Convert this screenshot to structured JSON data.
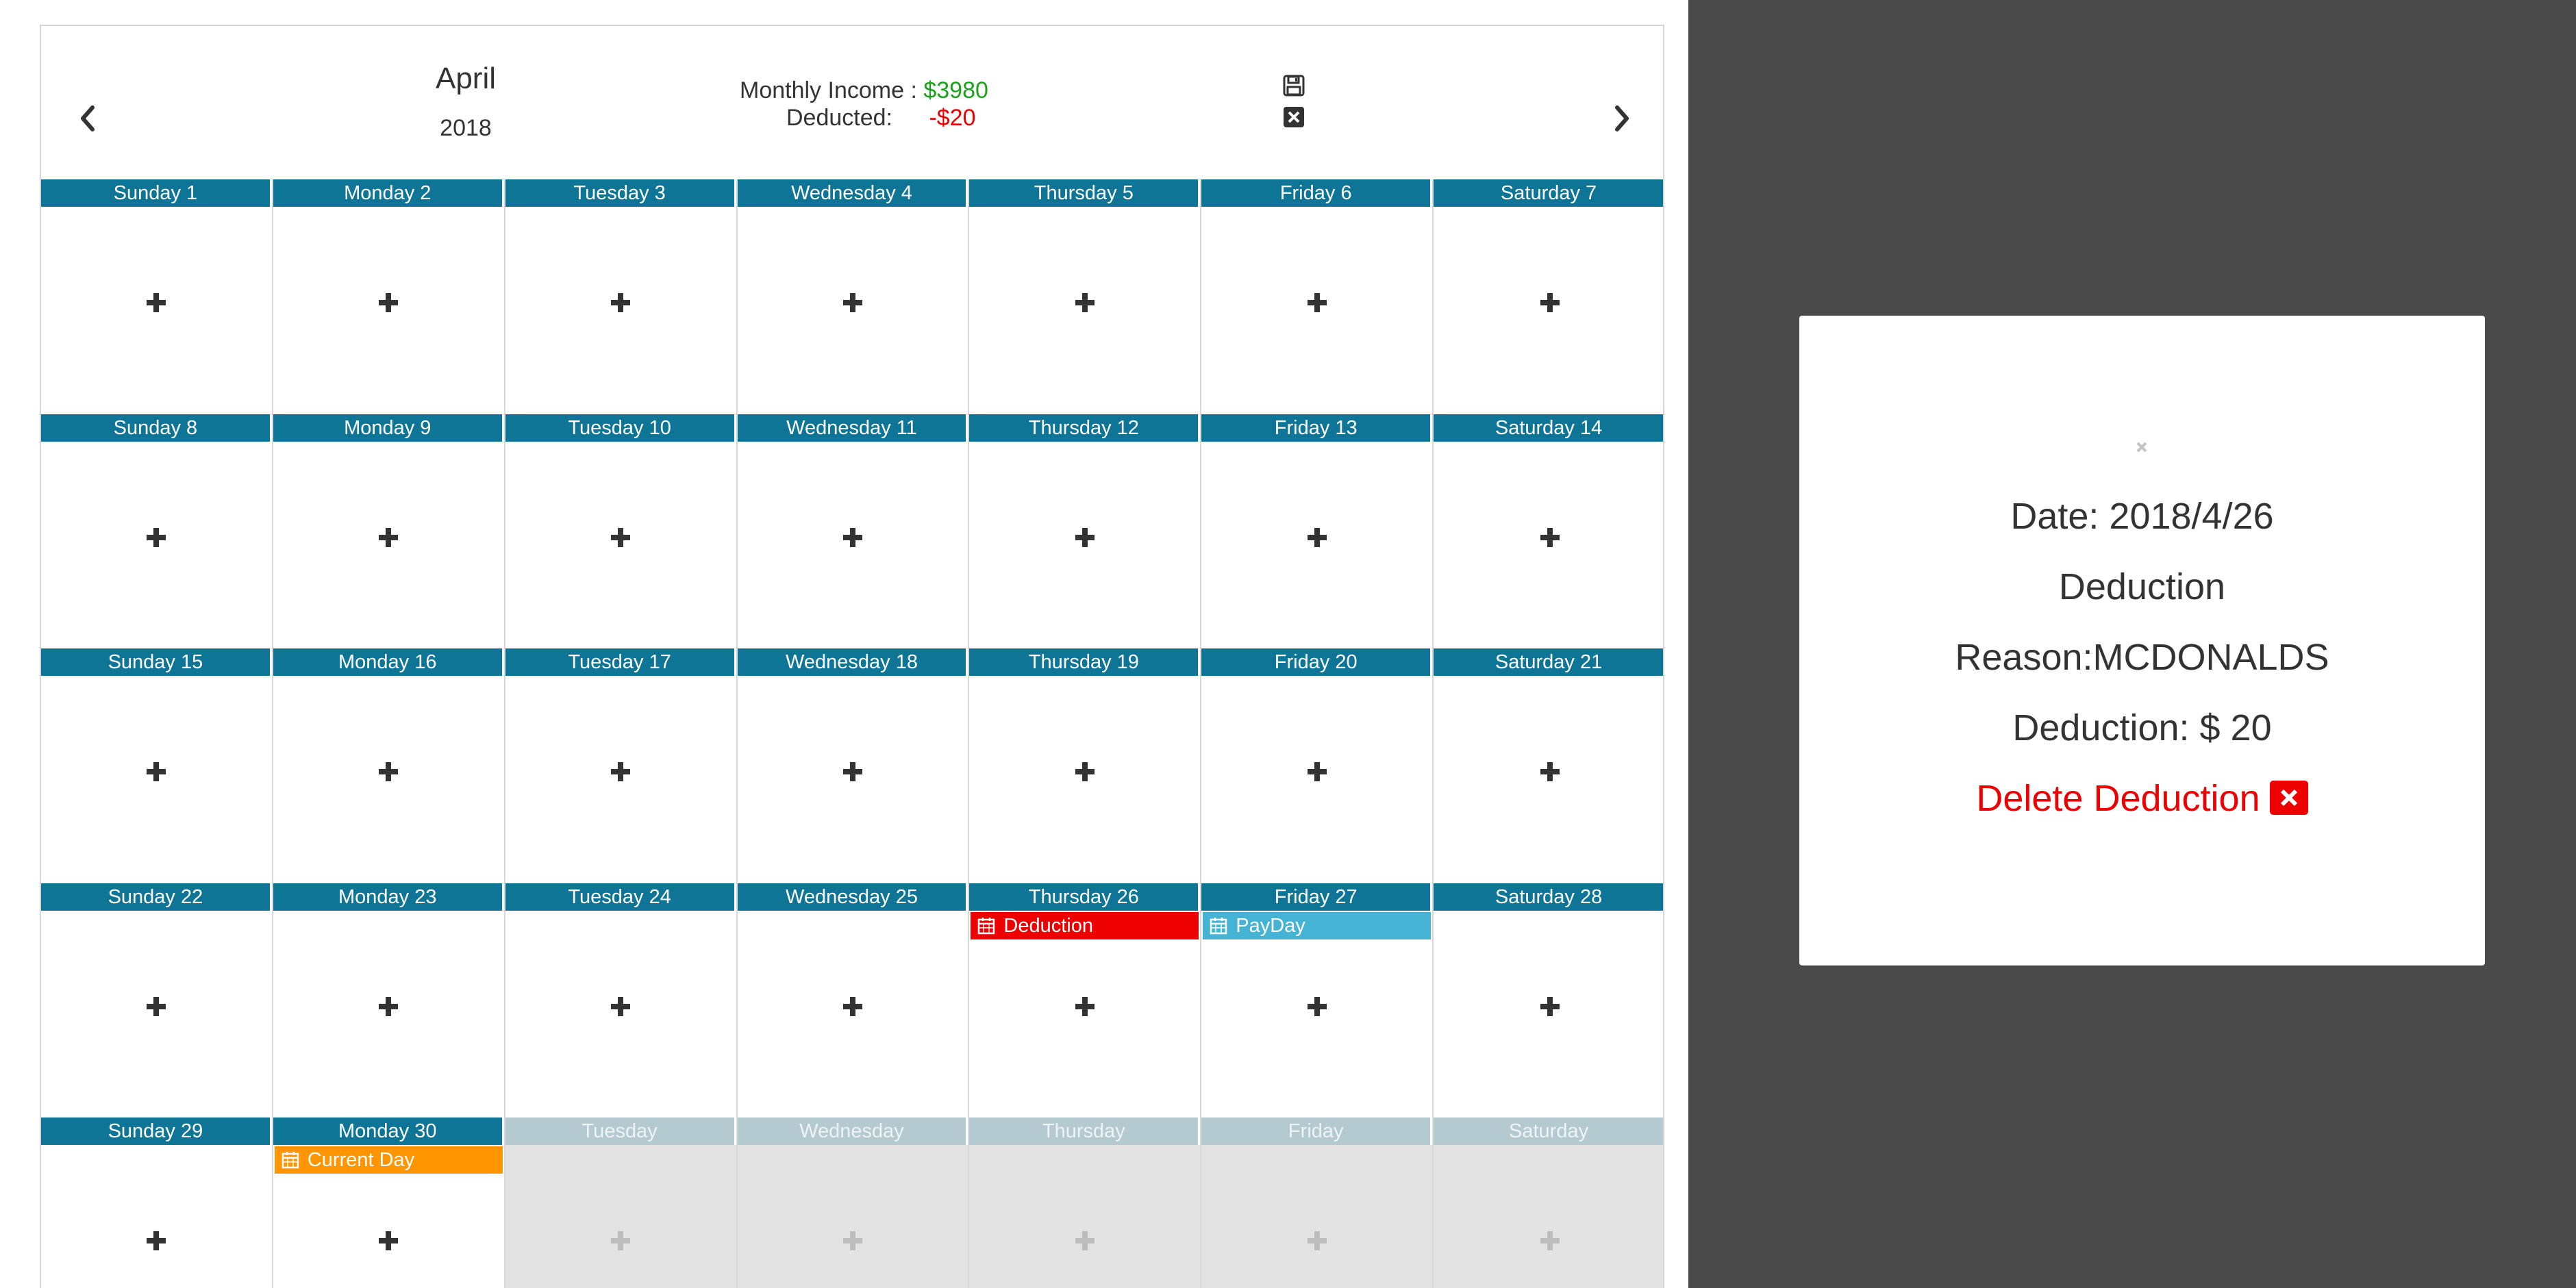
{
  "calendar": {
    "month": "April",
    "year": "2018",
    "summary": {
      "income_label": "Monthly Income :",
      "income_value": "$3980",
      "deducted_label": "Deducted:",
      "deducted_value": "-$20"
    },
    "icons": {
      "prev": "chevron-left-icon",
      "next": "chevron-right-icon",
      "save": "floppy-disk-icon",
      "clear": "close-square-icon",
      "add": "plus-icon",
      "event": "calendar-icon"
    },
    "colors": {
      "header": "#0e7596",
      "header_inactive": "#b5c9d0",
      "income": "#1aa31a",
      "deducted": "#ee0000",
      "event_deduction": "#ee0000",
      "event_payday": "#44b3d4",
      "event_current_day": "#ff9500",
      "overlay": "#4a4a4a"
    },
    "weeks": [
      [
        {
          "label": "Sunday 1"
        },
        {
          "label": "Monday 2"
        },
        {
          "label": "Tuesday 3"
        },
        {
          "label": "Wednesday 4"
        },
        {
          "label": "Thursday 5"
        },
        {
          "label": "Friday 6"
        },
        {
          "label": "Saturday 7"
        }
      ],
      [
        {
          "label": "Sunday 8"
        },
        {
          "label": "Monday 9"
        },
        {
          "label": "Tuesday 10"
        },
        {
          "label": "Wednesday 11"
        },
        {
          "label": "Thursday 12"
        },
        {
          "label": "Friday 13"
        },
        {
          "label": "Saturday 14"
        }
      ],
      [
        {
          "label": "Sunday 15"
        },
        {
          "label": "Monday 16"
        },
        {
          "label": "Tuesday 17"
        },
        {
          "label": "Wednesday 18"
        },
        {
          "label": "Thursday 19"
        },
        {
          "label": "Friday 20"
        },
        {
          "label": "Saturday 21"
        }
      ],
      [
        {
          "label": "Sunday 22"
        },
        {
          "label": "Monday 23"
        },
        {
          "label": "Tuesday 24"
        },
        {
          "label": "Wednesday 25"
        },
        {
          "label": "Thursday 26",
          "event": {
            "text": "Deduction",
            "type": "deduction"
          }
        },
        {
          "label": "Friday 27",
          "event": {
            "text": "PayDay",
            "type": "payday"
          }
        },
        {
          "label": "Saturday 28"
        }
      ],
      [
        {
          "label": "Sunday 29"
        },
        {
          "label": "Monday 30",
          "event": {
            "text": "Current Day",
            "type": "current"
          }
        },
        {
          "label": "Tuesday",
          "inactive": true
        },
        {
          "label": "Wednesday",
          "inactive": true
        },
        {
          "label": "Thursday",
          "inactive": true
        },
        {
          "label": "Friday",
          "inactive": true
        },
        {
          "label": "Saturday",
          "inactive": true
        }
      ]
    ]
  },
  "modal": {
    "close_icon": "close-icon",
    "date_line": "Date: 2018/4/26",
    "type_line": "Deduction",
    "reason_line": "Reason:MCDONALDS",
    "amount_line": "Deduction: $ 20",
    "delete_label": "Delete Deduction",
    "delete_icon": "close-square-icon"
  }
}
